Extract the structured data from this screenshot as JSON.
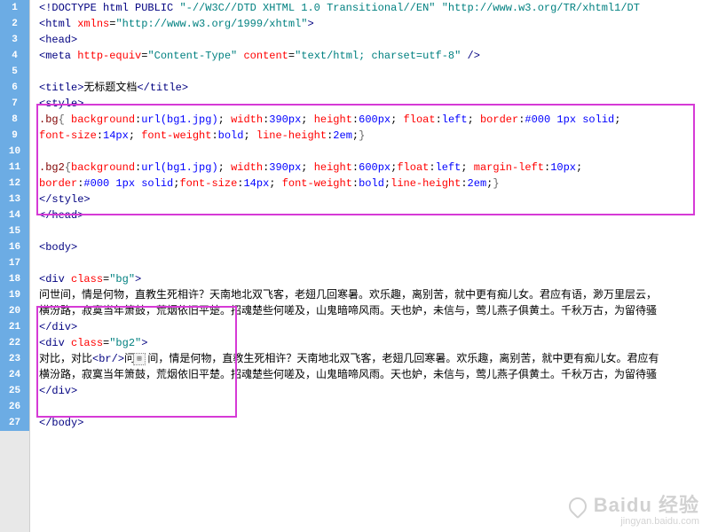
{
  "total_lines": 27,
  "lines": [
    {
      "n": 1,
      "html": "<span class='t-punc'>&lt;!</span><span class='t-tag'>DOCTYPE html PUBLIC</span> <span class='t-str'>\"-//W3C//DTD XHTML 1.0 Transitional//EN\"</span> <span class='t-str'>\"http://www.w3.org/TR/xhtml1/DT</span>"
    },
    {
      "n": 2,
      "html": "<span class='t-punc'>&lt;</span><span class='t-tag'>html</span> <span class='t-attn'>xmlns</span>=<span class='t-str'>\"http://www.w3.org/1999/xhtml\"</span><span class='t-punc'>&gt;</span>"
    },
    {
      "n": 3,
      "html": "<span class='t-punc'>&lt;</span><span class='t-tag'>head</span><span class='t-punc'>&gt;</span>"
    },
    {
      "n": 4,
      "html": "<span class='t-punc'>&lt;</span><span class='t-tag'>meta</span> <span class='t-attn'>http-equiv</span>=<span class='t-str'>\"Content-Type\"</span> <span class='t-attn'>content</span>=<span class='t-str'>\"text/html; charset=utf-8\"</span> <span class='t-punc'>/&gt;</span>"
    },
    {
      "n": 5,
      "html": ""
    },
    {
      "n": 6,
      "html": "<span class='t-punc'>&lt;</span><span class='t-tag'>title</span><span class='t-punc'>&gt;</span><span class='t-text'>无标题文档</span><span class='t-punc'>&lt;/</span><span class='t-tag'>title</span><span class='t-punc'>&gt;</span>"
    },
    {
      "n": 7,
      "html": "<span class='t-punc'>&lt;</span><span class='t-tag'>style</span><span class='t-punc'>&gt;</span>"
    },
    {
      "n": 8,
      "html": "<span class='t-css-sel'>.bg</span><span class='t-brace'>{</span> <span class='t-css-prop'>background</span>:<span class='t-css-val'>url(bg1.jpg)</span>; <span class='t-css-prop'>width</span>:<span class='t-css-val'>390px</span>; <span class='t-css-prop'>height</span>:<span class='t-css-val'>600px</span>; <span class='t-css-prop'>float</span>:<span class='t-css-val'>left</span>; <span class='t-css-prop'>border</span>:<span class='t-css-val'>#000 1px solid</span>;"
    },
    {
      "n": 9,
      "html": "<span class='t-css-prop'>font-size</span>:<span class='t-css-val'>14px</span>; <span class='t-css-prop'>font-weight</span>:<span class='t-css-val'>bold</span>; <span class='t-css-prop'>line-height</span>:<span class='t-css-val'>2em</span>;<span class='t-brace'>}</span>"
    },
    {
      "n": 10,
      "html": ""
    },
    {
      "n": 11,
      "html": "<span class='t-css-sel'>.bg2</span><span class='t-brace'>{</span><span class='t-css-prop'>background</span>:<span class='t-css-val'>url(bg1.jpg)</span>; <span class='t-css-prop'>width</span>:<span class='t-css-val'>390px</span>; <span class='t-css-prop'>height</span>:<span class='t-css-val'>600px</span>;<span class='t-css-prop'>float</span>:<span class='t-css-val'>left</span>; <span class='t-css-prop'>margin-left</span>:<span class='t-css-val'>10px</span>;"
    },
    {
      "n": 12,
      "html": "<span class='t-css-prop'>border</span>:<span class='t-css-val'>#000 1px solid</span>;<span class='t-css-prop'>font-size</span>:<span class='t-css-val'>14px</span>; <span class='t-css-prop'>font-weight</span>:<span class='t-css-val'>bold</span>;<span class='t-css-prop'>line-height</span>:<span class='t-css-val'>2em</span>;<span class='t-brace'>}</span>"
    },
    {
      "n": 13,
      "html": "<span class='t-punc'>&lt;/</span><span class='t-tag'>style</span><span class='t-punc'>&gt;</span>"
    },
    {
      "n": 14,
      "html": "<span class='t-punc'>&lt;/</span><span class='t-tag'>head</span><span class='t-punc'>&gt;</span>"
    },
    {
      "n": 15,
      "html": ""
    },
    {
      "n": 16,
      "html": "<span class='t-punc'>&lt;</span><span class='t-tag'>body</span><span class='t-punc'>&gt;</span>"
    },
    {
      "n": 17,
      "html": ""
    },
    {
      "n": 18,
      "html": "<span class='t-punc'>&lt;</span><span class='t-tag'>div</span> <span class='t-attn'>class</span>=<span class='t-str'>\"bg\"</span><span class='t-punc'>&gt;</span>"
    },
    {
      "n": 19,
      "html": "<span class='t-text'>问世间，情是何物，直教生死相许？天南地北双飞客，老翅几回寒暑。欢乐趣，离别苦，就中更有痴儿女。君应有语，渺万里层云，</span>"
    },
    {
      "n": 20,
      "html": "<span class='t-text'>横汾路，寂寞当年箫鼓，荒烟依旧平楚。招魂楚些何嗟及，山鬼暗啼风雨。天也妒，未信与，莺儿燕子俱黄土。千秋万古，为留待骚</span>"
    },
    {
      "n": 21,
      "html": "<span class='t-punc'>&lt;/</span><span class='t-tag'>div</span><span class='t-punc'>&gt;</span>"
    },
    {
      "n": 22,
      "html": "<span class='t-punc'>&lt;</span><span class='t-tag'>div</span> <span class='t-attn'>class</span>=<span class='t-str'>\"bg2\"</span><span class='t-punc'>&gt;</span>"
    },
    {
      "n": 23,
      "html": "<span class='t-text'>对比，对比</span><span class='t-punc'>&lt;</span><span class='t-tag'>br</span><span class='t-punc'>/&gt;</span><span class='t-text'>问&nbsp;&nbsp;间，情是何物，直教生死相许？天南地北双飞客，老翅几回寒暑。欢乐趣，离别苦，就中更有痴儿女。君应有</span>"
    },
    {
      "n": 24,
      "html": "<span class='t-text'>横汾路，寂寞当年箫鼓，荒烟依旧平楚。招魂楚些何嗟及，山鬼暗啼风雨。天也妒，未信与，莺儿燕子俱黄土。千秋万古，为留待骚</span>"
    },
    {
      "n": 25,
      "html": "<span class='t-punc'>&lt;/</span><span class='t-tag'>div</span><span class='t-punc'>&gt;</span>"
    },
    {
      "n": 26,
      "html": ""
    },
    {
      "n": 27,
      "html": "<span class='t-punc'>&lt;/</span><span class='t-tag'>body</span><span class='t-punc'>&gt;</span>"
    }
  ],
  "watermark": {
    "main": "Baidu 经验",
    "sub": "jingyan.baidu.com"
  },
  "cursor_glyph": "⊞"
}
